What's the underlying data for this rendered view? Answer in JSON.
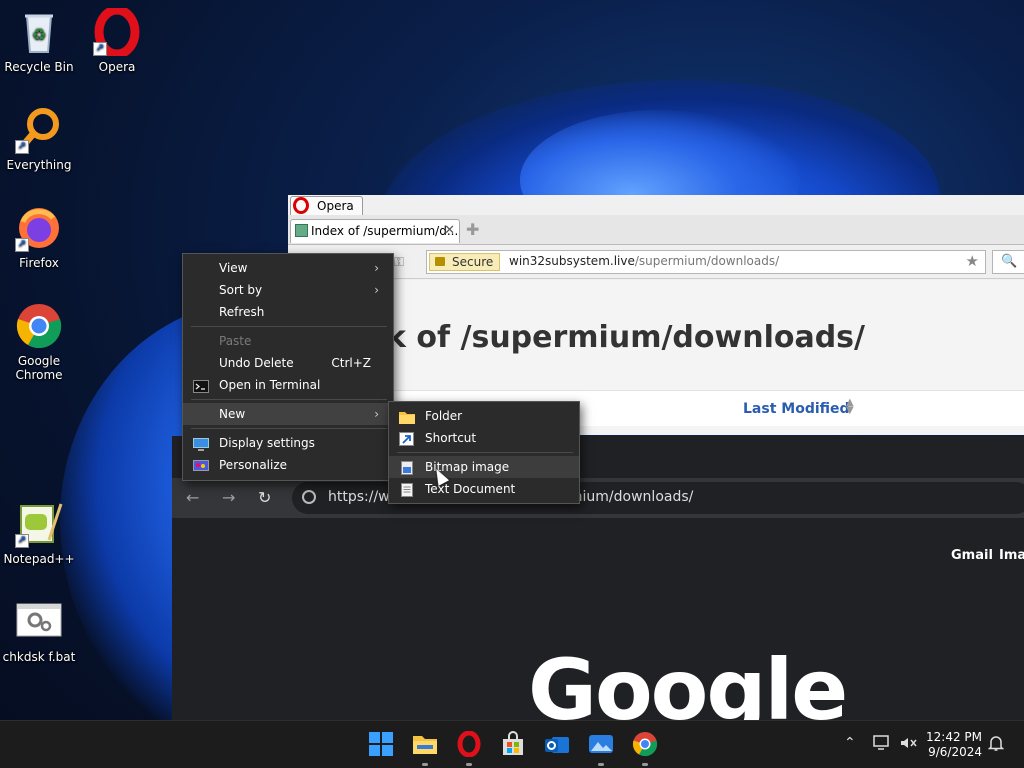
{
  "desktop": {
    "icons": [
      {
        "label": "Recycle Bin"
      },
      {
        "label": "Opera"
      },
      {
        "label": "Everything"
      },
      {
        "label": "Firefox"
      },
      {
        "label": "Google Chrome"
      },
      {
        "label": "Notepad++"
      },
      {
        "label": "chkdsk f.bat"
      }
    ]
  },
  "opera": {
    "title_tab": "Opera",
    "tab_title": "Index of /supermium/d...",
    "secure_label": "Secure",
    "url_host": "win32subsystem.live",
    "url_path": "/supermium/downloads/",
    "page_heading": "k of /supermium/downloads/",
    "column_last_modified": "Last Modified"
  },
  "chrome": {
    "url": "https://win32subsystem.live/supermium/downloads/",
    "gmail_link": "Gmail",
    "images_link": "Imag",
    "logo_text": "Google"
  },
  "context_menu": {
    "items": [
      {
        "label": "View"
      },
      {
        "label": "Sort by"
      },
      {
        "label": "Refresh"
      },
      {
        "label": "Paste"
      },
      {
        "label": "Undo Delete",
        "shortcut": "Ctrl+Z"
      },
      {
        "label": "Open in Terminal"
      },
      {
        "label": "New"
      },
      {
        "label": "Display settings"
      },
      {
        "label": "Personalize"
      }
    ]
  },
  "submenu_new": {
    "items": [
      {
        "label": "Folder"
      },
      {
        "label": "Shortcut"
      },
      {
        "label": "Bitmap image"
      },
      {
        "label": "Text Document"
      }
    ]
  },
  "taskbar": {
    "time": "12:42 PM",
    "date": "9/6/2024"
  },
  "colors": {
    "accent": "#2a5db0",
    "menu_bg": "#2b2b2b",
    "taskbar_bg": "#1c1c1c"
  }
}
